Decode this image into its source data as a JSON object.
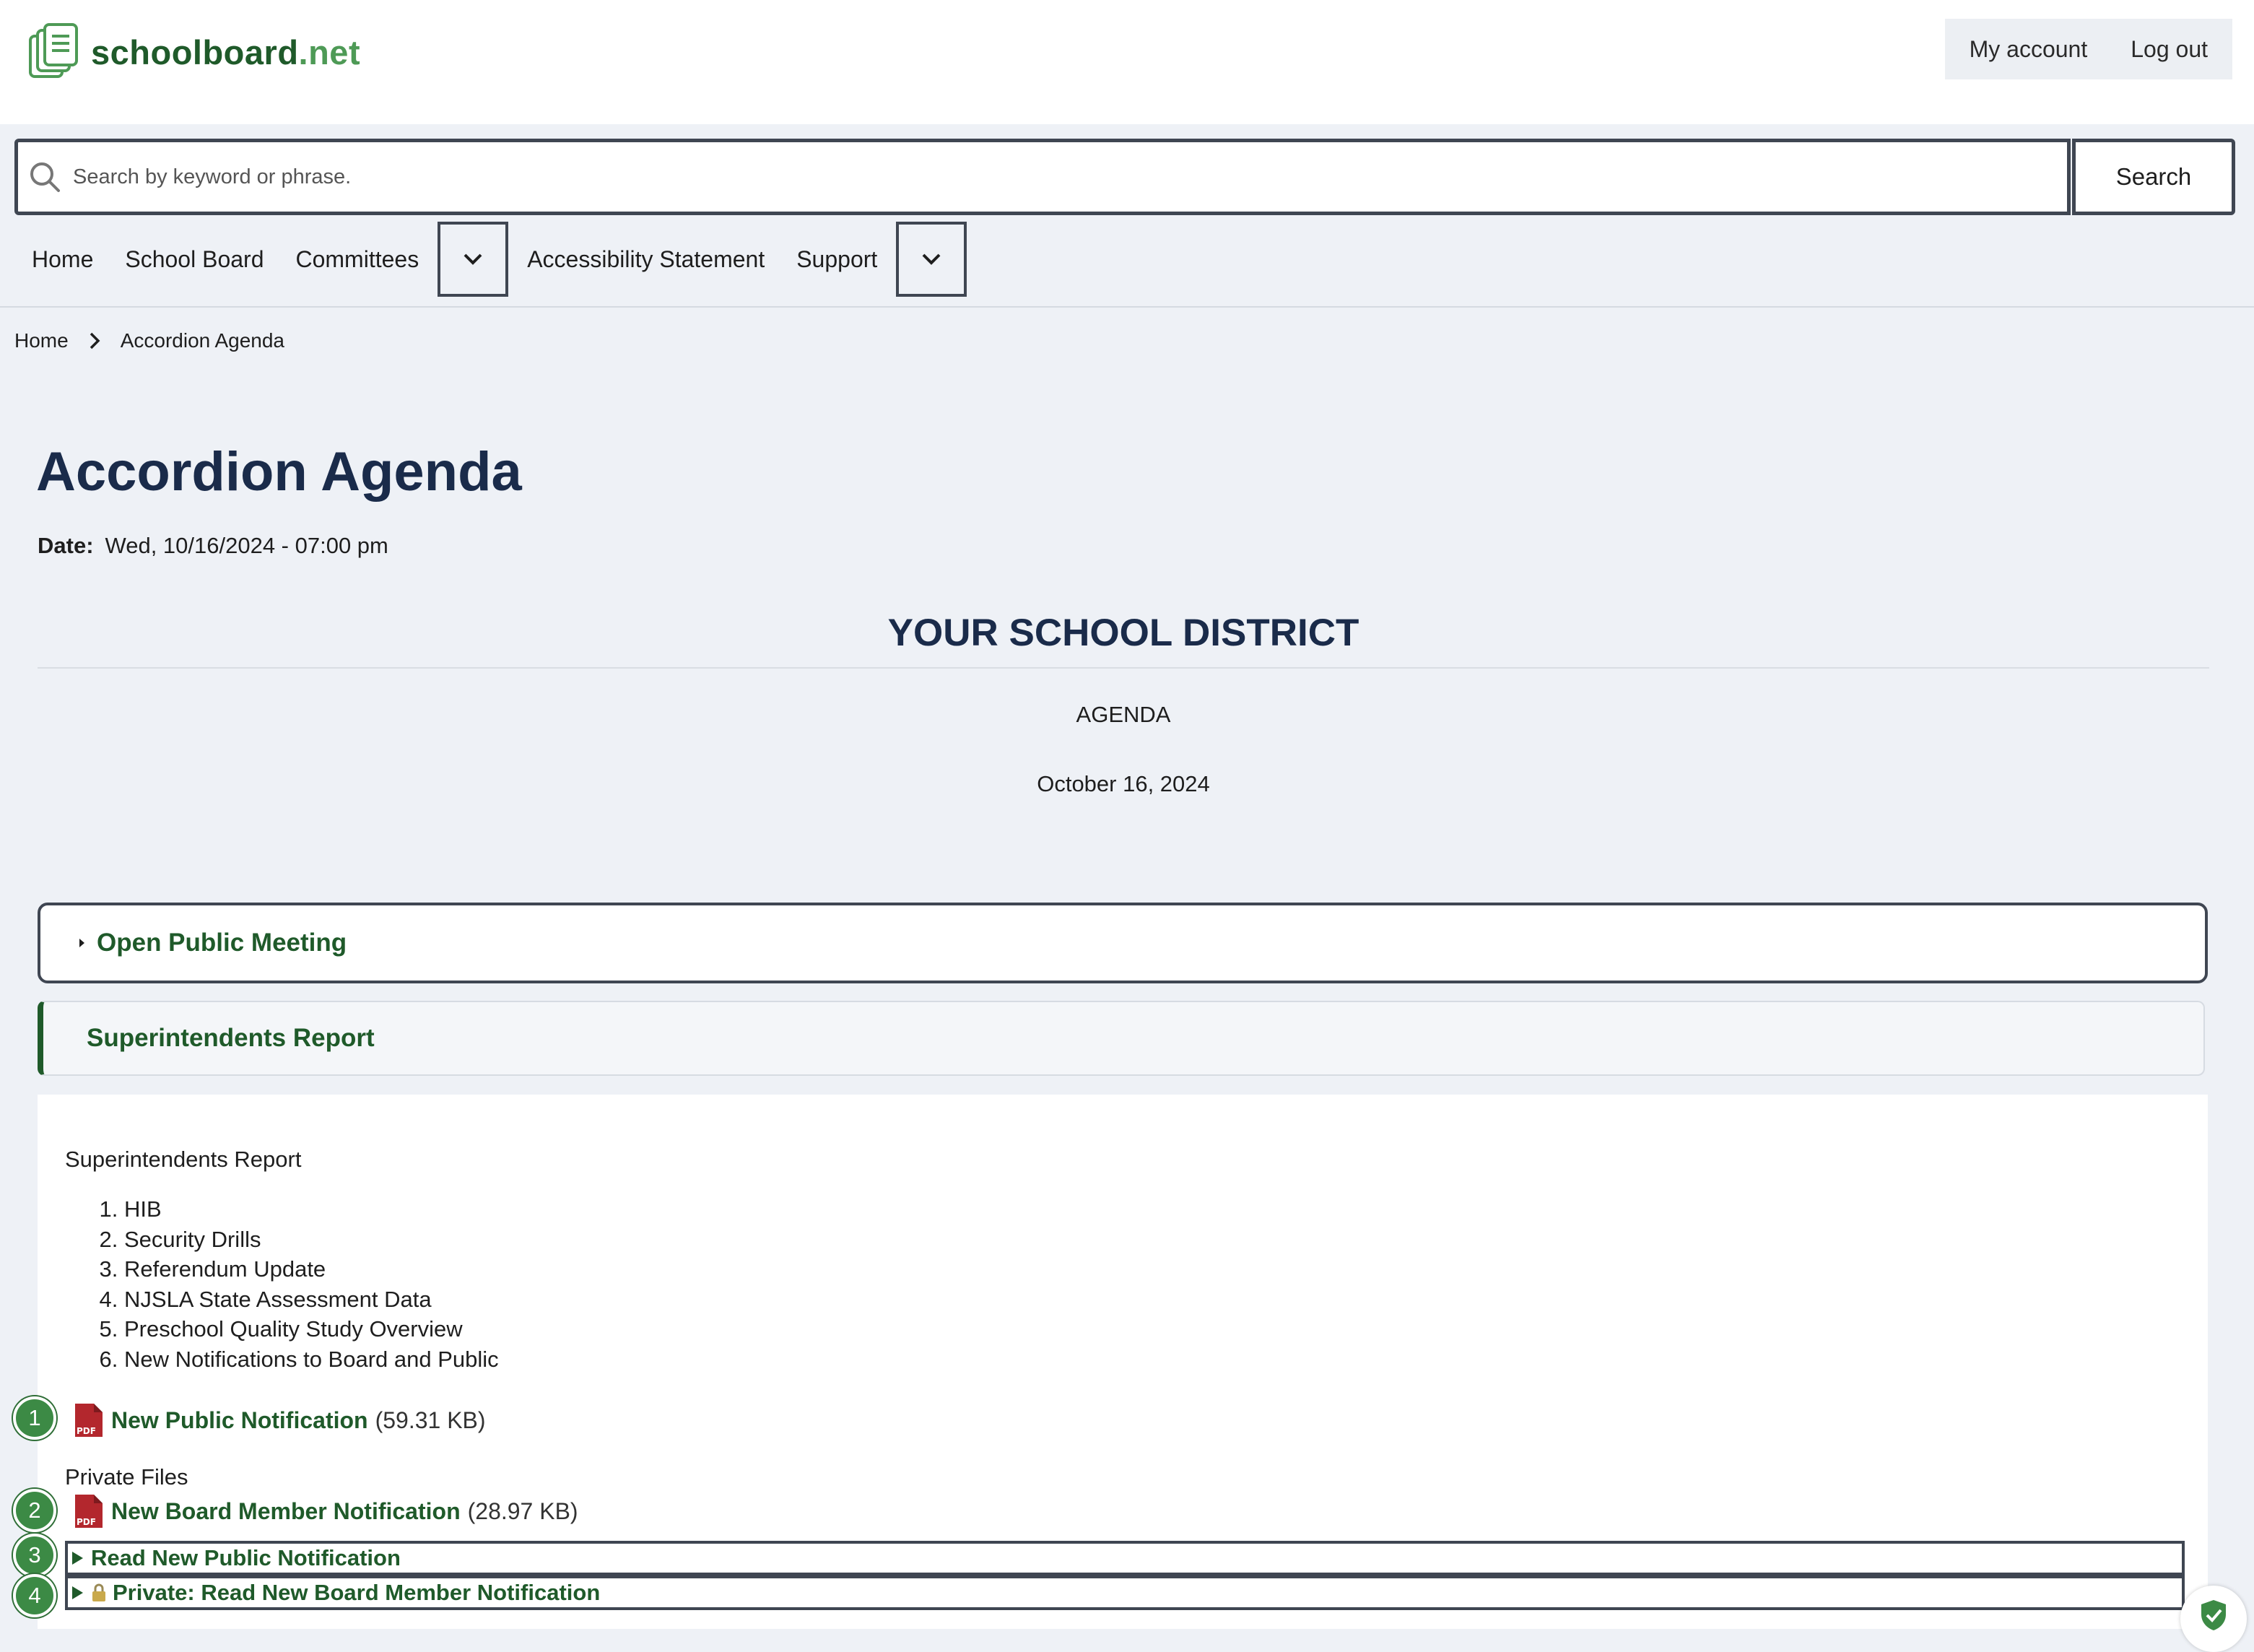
{
  "site": {
    "logo_text": "schoolboard",
    "logo_suffix": ".net"
  },
  "account": {
    "my_account": "My account",
    "log_out": "Log out"
  },
  "search": {
    "placeholder": "Search by keyword or phrase.",
    "button": "Search"
  },
  "nav": {
    "home": "Home",
    "school_board": "School Board",
    "committees": "Committees",
    "accessibility": "Accessibility Statement",
    "support": "Support"
  },
  "breadcrumb": {
    "home": "Home",
    "current": "Accordion Agenda"
  },
  "page": {
    "title": "Accordion Agenda",
    "date_label": "Date:",
    "date_value": "Wed, 10/16/2024 - 07:00 pm",
    "district": "YOUR SCHOOL DISTRICT",
    "agenda": "AGENDA",
    "agenda_date": "October 16, 2024"
  },
  "accordions": {
    "open_public_meeting": "Open Public Meeting",
    "superintendents_report": "Superintendents Report"
  },
  "report": {
    "lead": "Superintendents Report",
    "items": [
      "HIB",
      "Security Drills",
      "Referendum Update",
      "NJSLA State Assessment Data",
      "Preschool Quality Study Overview",
      "New Notifications to Board and Public"
    ],
    "public_file": {
      "name": "New Public Notification",
      "size": "(59.31 KB)"
    },
    "private_label": "Private Files",
    "private_file": {
      "name": "New Board Member Notification",
      "size": "(28.97 KB)"
    },
    "read_public": "Read New Public Notification",
    "read_private": "Private: Read New Board Member Notification"
  },
  "badges": [
    "1",
    "2",
    "3",
    "4"
  ],
  "colors": {
    "brand_green": "#1f5a2a",
    "badge_green": "#3c8a45",
    "navy": "#1a2b4a"
  }
}
